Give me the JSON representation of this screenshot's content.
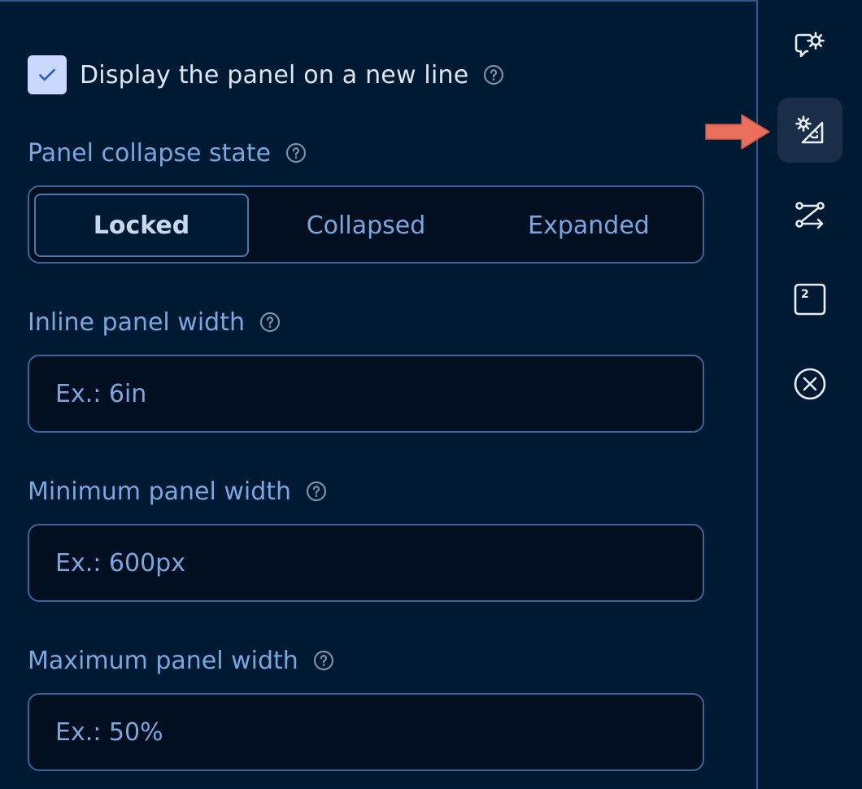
{
  "settings": {
    "new_line_checkbox": {
      "label": "Display the panel on a new line",
      "checked": true
    },
    "collapse_state": {
      "label": "Panel collapse state",
      "options": [
        "Locked",
        "Collapsed",
        "Expanded"
      ],
      "selected": "Locked"
    },
    "inline_width": {
      "label": "Inline panel width",
      "placeholder": "Ex.: 6in"
    },
    "min_width": {
      "label": "Minimum panel width",
      "placeholder": "Ex.: 600px"
    },
    "max_width": {
      "label": "Maximum panel width",
      "placeholder": "Ex.: 50%"
    }
  },
  "rail": {
    "items": [
      {
        "icon": "chat-settings-icon",
        "active": false
      },
      {
        "icon": "layout-settings-icon",
        "active": true
      },
      {
        "icon": "route-icon",
        "active": false
      },
      {
        "icon": "number-box-icon",
        "text": "2",
        "active": false
      },
      {
        "icon": "close-circle-icon",
        "active": false
      }
    ]
  },
  "colors": {
    "background": "#011a33",
    "accent": "#7aa7df",
    "border": "#3c6699",
    "annotation_arrow": "#e8705c"
  }
}
